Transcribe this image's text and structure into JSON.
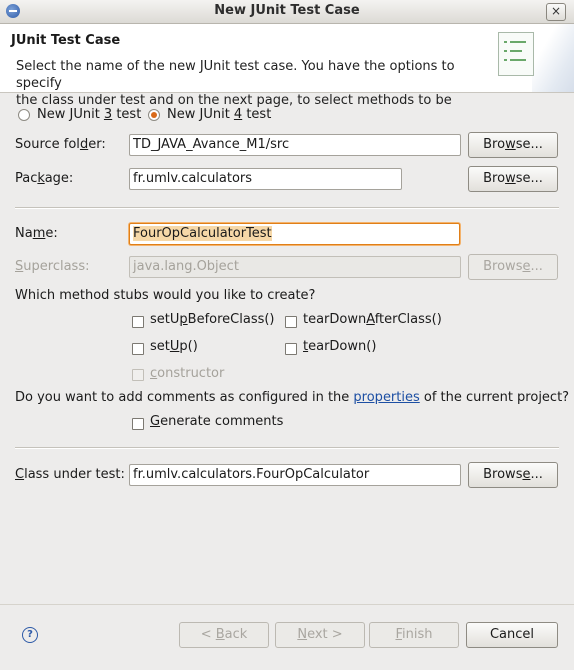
{
  "window": {
    "title": "New JUnit Test Case",
    "close_label": "×"
  },
  "header": {
    "title": "JUnit Test Case",
    "description_line1": "Select the name of the new JUnit test case. You have the options to specify",
    "description_line2": "the class under test and on the next page, to select methods to be"
  },
  "version": {
    "junit3_pre": "New JUnit ",
    "junit3_key": "3",
    "junit3_post": " test",
    "junit4_pre": "New JUnit ",
    "junit4_key": "4",
    "junit4_post": " test",
    "selected": "junit4"
  },
  "source_folder": {
    "label_pre": "Source fol",
    "label_key": "d",
    "label_post": "er:",
    "value": "TD_JAVA_Avance_M1/src",
    "browse_pre": "Bro",
    "browse_key": "w",
    "browse_post": "se..."
  },
  "package": {
    "label_pre": "Pac",
    "label_key": "k",
    "label_post": "age:",
    "value": "fr.umlv.calculators",
    "browse_pre": "Bro",
    "browse_key": "w",
    "browse_post": "se..."
  },
  "name": {
    "label_pre": "Na",
    "label_key": "m",
    "label_post": "e:",
    "value": "FourOpCalculatorTest"
  },
  "superclass": {
    "label_pre": "",
    "label_key": "S",
    "label_post": "uperclass:",
    "value": "java.lang.Object",
    "browse_pre": "Brows",
    "browse_key": "e",
    "browse_post": "..."
  },
  "stubs": {
    "question": "Which method stubs would you like to create?",
    "setUpBeforeClass_pre": "setU",
    "setUpBeforeClass_key": "p",
    "setUpBeforeClass_post": "BeforeClass()",
    "tearDownAfterClass_pre": "tearDown",
    "tearDownAfterClass_key": "A",
    "tearDownAfterClass_post": "fterClass()",
    "setUp_pre": "set",
    "setUp_key": "U",
    "setUp_post": "p()",
    "tearDown_pre": "",
    "tearDown_key": "t",
    "tearDown_post": "earDown()",
    "constructor_pre": "",
    "constructor_key": "c",
    "constructor_post": "onstructor"
  },
  "comments": {
    "question_pre": "Do you want to add comments as configured in the ",
    "question_link": "properties",
    "question_post": " of the current project?",
    "generate_pre": "",
    "generate_key": "G",
    "generate_post": "enerate comments"
  },
  "class_under_test": {
    "label_pre": "",
    "label_key": "C",
    "label_post": "lass under test:",
    "value": "fr.umlv.calculators.FourOpCalculator",
    "browse_pre": "Brows",
    "browse_key": "e",
    "browse_post": "..."
  },
  "footer": {
    "help_label": "?",
    "back_pre": "< ",
    "back_key": "B",
    "back_post": "ack",
    "next_pre": "",
    "next_key": "N",
    "next_post": "ext >",
    "finish_pre": "",
    "finish_key": "F",
    "finish_post": "inish",
    "cancel_label": "Cancel"
  }
}
